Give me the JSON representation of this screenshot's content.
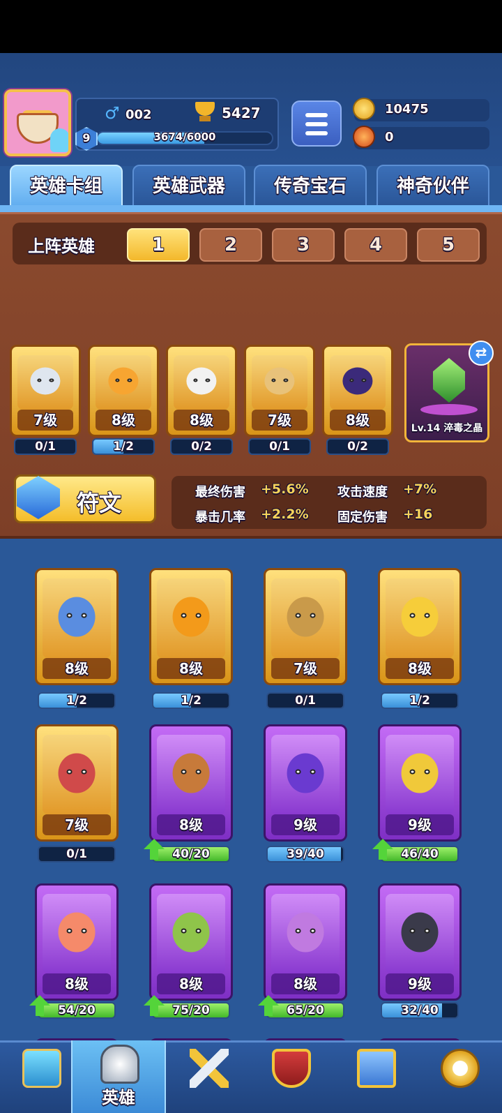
{
  "profile": {
    "hero_count": "002",
    "trophies": "5427",
    "level": "9",
    "xp_text": "3674/6000",
    "xp_fraction": 0.6123
  },
  "currency": {
    "coins": "10475",
    "gems": "0"
  },
  "tabs": [
    "英雄卡组",
    "英雄武器",
    "传奇宝石",
    "神奇伙伴"
  ],
  "lineup": {
    "label": "上阵英雄",
    "slots": [
      "1",
      "2",
      "3",
      "4",
      "5"
    ],
    "active_slot": 0,
    "heroes": [
      {
        "level": "7级",
        "progress": "0/1",
        "fraction": 0.0
      },
      {
        "level": "8级",
        "progress": "1/2",
        "fraction": 0.5
      },
      {
        "level": "8级",
        "progress": "0/2",
        "fraction": 0.0
      },
      {
        "level": "7级",
        "progress": "0/1",
        "fraction": 0.0
      },
      {
        "level": "8级",
        "progress": "0/2",
        "fraction": 0.0
      }
    ],
    "gem": {
      "label": "Lv.14 淬毒之晶"
    }
  },
  "rune": {
    "label": "符文",
    "stats": [
      {
        "name": "最终伤害",
        "value": "+5.6%"
      },
      {
        "name": "攻击速度",
        "value": "+7%"
      },
      {
        "name": "暴击几率",
        "value": "+2.2%"
      },
      {
        "name": "固定伤害",
        "value": "+16"
      }
    ]
  },
  "collection": [
    {
      "level": "8级",
      "progress": "1/2",
      "fraction": 0.5,
      "rarity": "gold",
      "upgradable": false
    },
    {
      "level": "8级",
      "progress": "1/2",
      "fraction": 0.5,
      "rarity": "gold",
      "upgradable": false
    },
    {
      "level": "7级",
      "progress": "0/1",
      "fraction": 0.0,
      "rarity": "gold",
      "upgradable": false
    },
    {
      "level": "8级",
      "progress": "1/2",
      "fraction": 0.5,
      "rarity": "gold",
      "upgradable": false
    },
    {
      "level": "7级",
      "progress": "0/1",
      "fraction": 0.0,
      "rarity": "gold",
      "upgradable": false
    },
    {
      "level": "8级",
      "progress": "40/20",
      "fraction": 1.0,
      "rarity": "purple",
      "upgradable": true
    },
    {
      "level": "9级",
      "progress": "39/40",
      "fraction": 0.975,
      "rarity": "purple",
      "upgradable": false
    },
    {
      "level": "9级",
      "progress": "46/40",
      "fraction": 1.0,
      "rarity": "purple",
      "upgradable": true
    },
    {
      "level": "8级",
      "progress": "54/20",
      "fraction": 1.0,
      "rarity": "purple",
      "upgradable": true
    },
    {
      "level": "8级",
      "progress": "75/20",
      "fraction": 1.0,
      "rarity": "purple",
      "upgradable": true
    },
    {
      "level": "8级",
      "progress": "65/20",
      "fraction": 1.0,
      "rarity": "purple",
      "upgradable": true
    },
    {
      "level": "9级",
      "progress": "32/40",
      "fraction": 0.8,
      "rarity": "purple",
      "upgradable": false
    }
  ],
  "nav": {
    "active_label": "英雄",
    "items": [
      "treasure-chest-icon",
      "knight-helmet-icon",
      "crossed-swords-icon",
      "crown-shield-icon",
      "team-flag-icon",
      "compass-icon"
    ]
  },
  "colors": {
    "background": "#2a5898",
    "lineup_panel": "#8b4a2e",
    "gold_card": "#f0b43a",
    "purple_card": "#a24fe0",
    "progress_blue": "#4aa6ec",
    "progress_green": "#54d43a"
  }
}
